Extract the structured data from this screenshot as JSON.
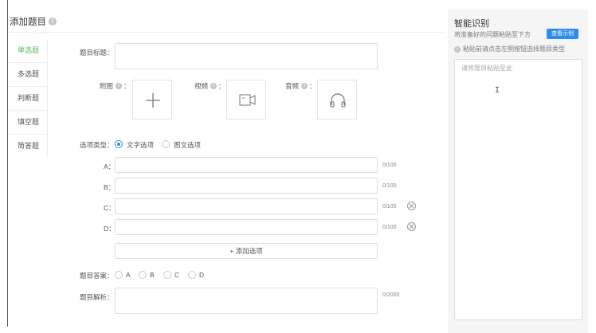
{
  "page_title": "添加题目",
  "tabs": [
    "单选题",
    "多选题",
    "判断题",
    "填空题",
    "简答题"
  ],
  "form": {
    "question_title_label": "题目标题：",
    "attachment_label": "附图",
    "video_label": "视频",
    "audio_label": "音频",
    "colon": "：",
    "option_type_label": "选项类型：",
    "option_type_text": "文字选项",
    "option_type_image": "图文选项",
    "options": [
      {
        "letter": "A：",
        "counter": "0/100"
      },
      {
        "letter": "B：",
        "counter": "0/100"
      },
      {
        "letter": "C：",
        "counter": "0/100"
      },
      {
        "letter": "D：",
        "counter": "0/100"
      }
    ],
    "add_option_label": "+ 添加选项",
    "answer_label": "题目答案：",
    "answer_choices": [
      "A",
      "B",
      "C",
      "D"
    ],
    "analysis_label": "题目解析：",
    "analysis_counter": "0/2000"
  },
  "side": {
    "title": "智能识别",
    "description": "将准备好的问题粘贴至下方",
    "example_button": "查看示例",
    "hint": "粘贴前请点击左侧按钮选择题目类型",
    "placeholder": "请将题目粘贴至此"
  },
  "icons": {
    "info": "info-icon",
    "plus": "plus-icon",
    "video": "video-camera-icon",
    "audio": "headphones-icon",
    "delete": "close-circle-icon"
  },
  "colors": {
    "accent": "#2d8cf0",
    "active_tab": "#5cb85c"
  }
}
